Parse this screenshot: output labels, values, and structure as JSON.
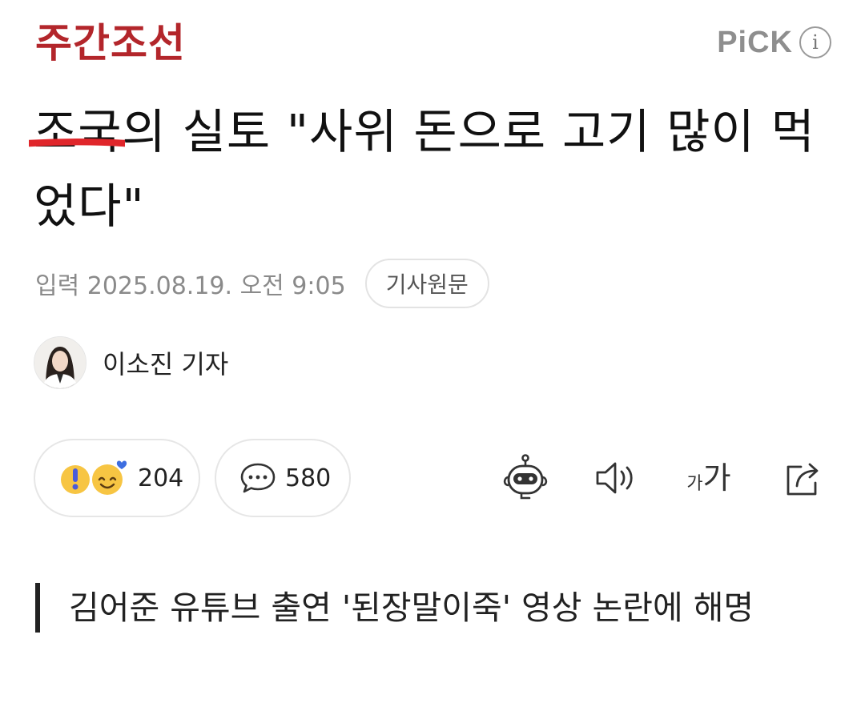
{
  "header": {
    "logo": "주간조선",
    "pick_label": "PiCK",
    "info_glyph": "i",
    "logo_color": "#b3262b"
  },
  "article": {
    "title_highlight": "조국의 실토",
    "title_rest": " \"사위 돈으로 고기 많이 먹었다\"",
    "date": "입력 2025.08.19. 오전 9:05",
    "original_button": "기사원문",
    "author": "이소진 기자",
    "lead": "김어준 유튜브 출연 '된장말이죽' 영상 논란에 해명",
    "underline_color": "#e0262b"
  },
  "reactions": {
    "count": "204",
    "comments": "580"
  },
  "tools": {
    "font_size_small": "가",
    "font_size_large": "가",
    "icons": [
      "robot-summary-icon",
      "speaker-icon",
      "font-size-icon",
      "share-icon"
    ]
  }
}
